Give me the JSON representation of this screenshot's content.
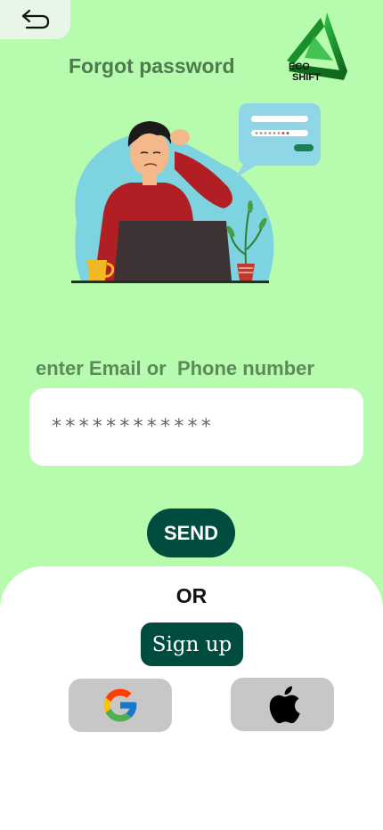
{
  "header": {
    "title": "Forgot password",
    "back_icon": "undo-arrow-icon"
  },
  "logo": {
    "line1": "ECO",
    "line2": "SHIFT",
    "color": "#1f9d2e"
  },
  "illustration": {
    "name": "confused-man-at-laptop-illustration"
  },
  "form": {
    "label": "enter Email or  Phone number",
    "value": "************",
    "send_label": "SEND"
  },
  "alt": {
    "or_label": "OR",
    "signup_label": "Sign up",
    "google_icon": "google-icon",
    "apple_icon": "apple-icon"
  },
  "colors": {
    "background": "#b6fbae",
    "primary": "#004d40",
    "panel": "#ffffff",
    "social_button": "#c7c7c7"
  }
}
